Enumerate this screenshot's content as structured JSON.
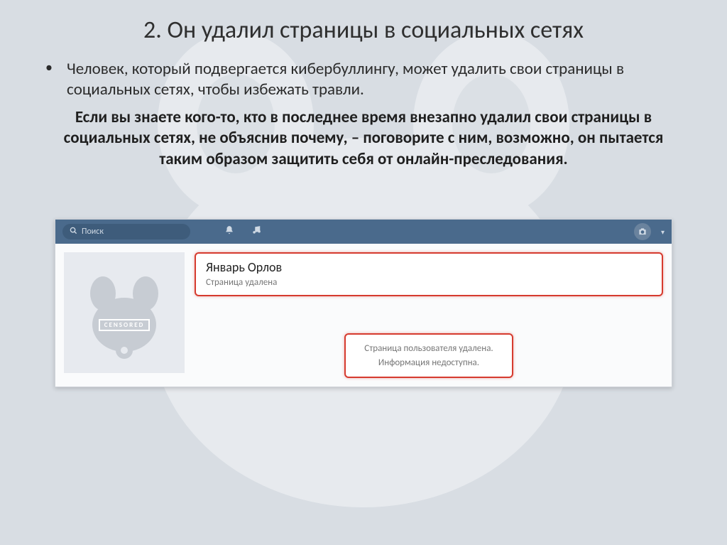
{
  "title": "2. Он удалил страницы в социальных сетях",
  "bullet": "Человек, который подвергается кибербуллингу, может удалить свои страницы в социальных сетях, чтобы избежать травли.",
  "emphasis": "Если вы знаете кого-то, кто в последнее время внезапно удалил свои страницы в социальных сетях, не объяснив почему, – поговорите с ним, возможно, он пытается таким образом защитить себя от онлайн-преследования.",
  "vk": {
    "search_placeholder": "Поиск",
    "censored_label": "CENSORED",
    "profile_name": "Январь Орлов",
    "profile_status": "Страница удалена",
    "deleted_line1": "Страница пользователя удалена.",
    "deleted_line2": "Информация недоступна."
  },
  "colors": {
    "vk_bar": "#4a6a8c",
    "highlight_border": "#d63b2f"
  }
}
